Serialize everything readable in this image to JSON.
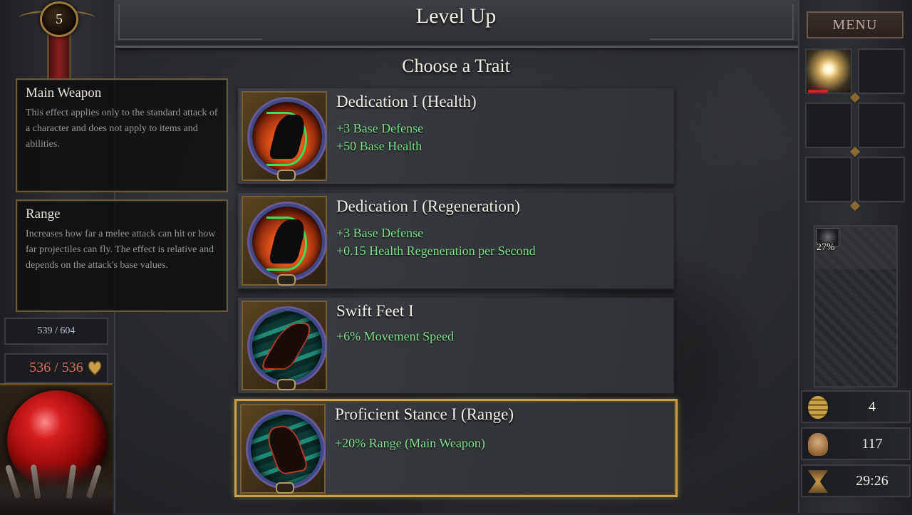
{
  "header": {
    "title": "Level Up",
    "subtitle": "Choose a Trait"
  },
  "player": {
    "level": "5",
    "mana": "539 / 604",
    "health": "536 / 536"
  },
  "tooltips": [
    {
      "title": "Main Weapon",
      "body": "This effect applies only to the standard attack of a character and does not apply to items and abilities."
    },
    {
      "title": "Range",
      "body": "Increases how far a melee attack can hit or how far projectiles can fly. The effect is relative and depends on the attack's base values."
    }
  ],
  "traits": [
    {
      "name": "Dedication I (Health)",
      "effects": [
        "+3 Base Defense",
        "+50 Base Health"
      ],
      "icon": "archer-fire-icon",
      "selected": false
    },
    {
      "name": "Dedication I (Regeneration)",
      "effects": [
        "+3 Base Defense",
        "+0.15 Health Regeneration per Second"
      ],
      "icon": "archer-fire-icon",
      "selected": false
    },
    {
      "name": "Swift Feet I",
      "effects": [
        "+6% Movement Speed"
      ],
      "icon": "runner-teal-icon",
      "selected": false
    },
    {
      "name": "Proficient Stance I (Range)",
      "effects": [
        "+20% Range (Main Weapon)"
      ],
      "icon": "leaping-figure-teal-icon",
      "selected": true
    }
  ],
  "sidebar": {
    "menu_label": "MENU",
    "xp_percent_label": "27%",
    "xp_fraction": 0.27,
    "resources": {
      "coins": "4",
      "kills": "117",
      "time": "29:26"
    }
  },
  "colors": {
    "effect_text": "#7fe08a",
    "selected_border": "#c9a14a",
    "health_text": "#e06a5a",
    "health_orb": "#c01414"
  }
}
